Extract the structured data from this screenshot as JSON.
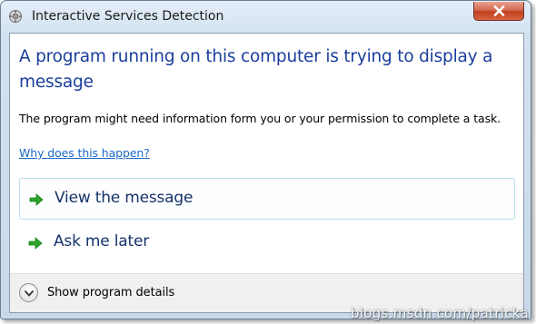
{
  "window": {
    "title": "Interactive Services Detection",
    "app_icon": "interactive-services-icon",
    "close_icon": "close-x-icon"
  },
  "dialog": {
    "main_instruction": "A program running on this computer is trying to display a message",
    "content": "The program might need information form you or your permission to complete a task.",
    "help_link": "Why does this happen?"
  },
  "commands": [
    {
      "label": "View the message",
      "icon": "green-arrow-icon",
      "hovered": true
    },
    {
      "label": "Ask me later",
      "icon": "green-arrow-icon",
      "hovered": false
    }
  ],
  "footer": {
    "details_label": "Show program details",
    "details_icon": "chevron-down-icon"
  },
  "watermark": "blogs.msdn.com/patricka",
  "colors": {
    "main_instruction": "#1a3e9c",
    "link": "#1c69c9",
    "command_text": "#15336a",
    "arrow_green": "#2aa52a",
    "close_red": "#c2401f"
  }
}
